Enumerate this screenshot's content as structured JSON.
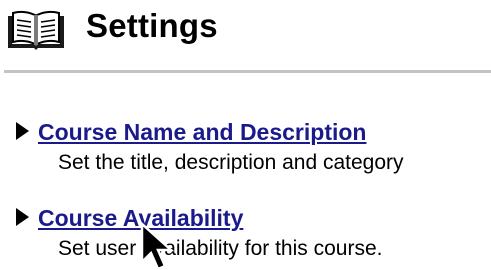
{
  "header": {
    "icon": "open-book-icon",
    "title": "Settings"
  },
  "items": [
    {
      "icon": "triangle-right-icon",
      "link": "Course Name and Description",
      "description": "Set the title, description and category"
    },
    {
      "icon": "triangle-right-icon",
      "link": "Course Availability",
      "description": "Set user availability for this course."
    }
  ],
  "colors": {
    "link": "#1a1a8c",
    "divider": "#c4c4c4",
    "text": "#000000"
  },
  "cursor": "arrow-pointer-icon"
}
